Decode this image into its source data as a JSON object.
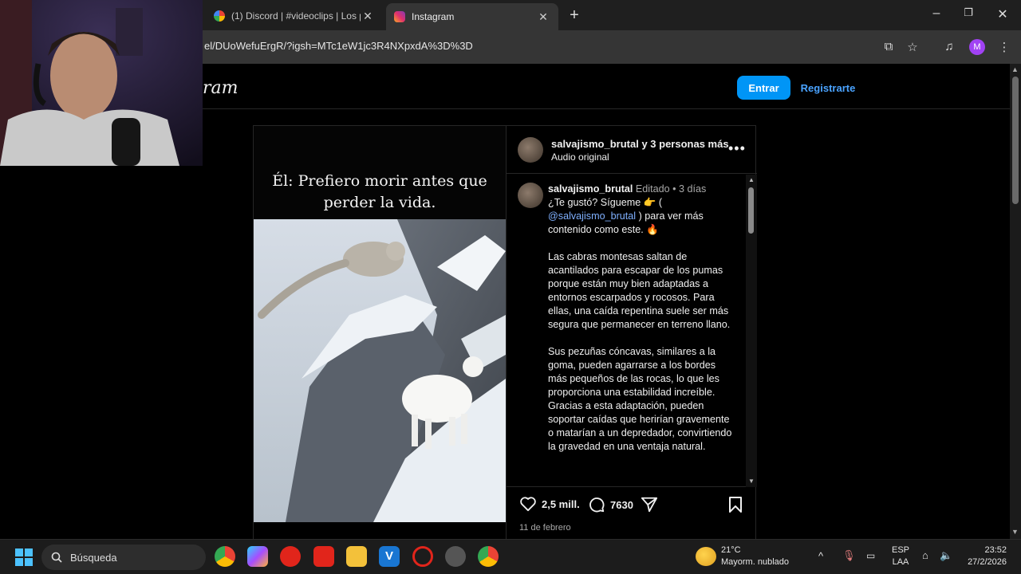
{
  "browser": {
    "tabs": [
      {
        "title": "(1) Discord | #videoclips | Los p",
        "active": false
      },
      {
        "title": "Instagram",
        "active": true
      }
    ],
    "url": "el/DUoWefuErgR/?igsh=MTc1eW1jc3R4NXpxdA%3D%3D",
    "profile_initial": "M"
  },
  "instagram": {
    "logo": "ram",
    "login_label": "Entrar",
    "signup_label": "Registrarte",
    "post": {
      "video_caption": "Él: Prefiero morir antes que perder la vida.",
      "header_user": "salvajismo_brutal y 3 personas más",
      "header_sub": "Audio original",
      "comment_user": "salvajismo_brutal",
      "comment_meta": "Editado • 3 días",
      "comment_intro": "¿Te gustó? Sígueme 👉 (",
      "comment_mention": "@salvajismo_brutal",
      "comment_intro_end": ") para ver más contenido como este. 🔥",
      "paragraph_1": "Las cabras montesas saltan de acantilados para escapar de los pumas porque están muy bien adaptadas a entornos escarpados y rocosos. Para ellas, una caída repentina suele ser más segura que permanecer en terreno llano.",
      "paragraph_2": "Sus pezuñas cóncavas, similares a la goma, pueden agarrarse a los bordes más pequeños de las rocas, lo que les proporciona una estabilidad increíble. Gracias a esta adaptación, pueden soportar caídas que herirían gravemente o matarían a un depredador, convirtiendo la gravedad en una ventaja natural.",
      "likes": "2,5 mill.",
      "comments": "7630",
      "date": "11 de febrero"
    }
  },
  "taskbar": {
    "search_label": "Búsqueda",
    "weather_temp": "21°C",
    "weather_desc": "Mayorm. nublado",
    "lang_1": "ESP",
    "lang_2": "LAA",
    "time": "23:52",
    "date": "27/2/2026"
  },
  "colors": {
    "accent": "#0095f6",
    "link": "#4aa3ff",
    "profile": "#a142f4"
  }
}
